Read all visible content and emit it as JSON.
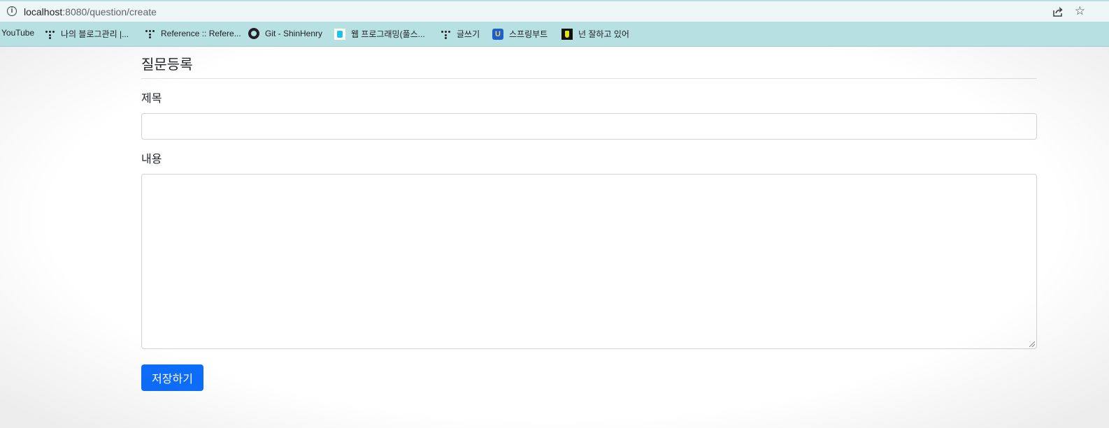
{
  "browser": {
    "url_host": "localhost",
    "url_path": ":8080/question/create",
    "bookmarks": [
      {
        "label": "YouTube",
        "icon": "none"
      },
      {
        "label": "나의 블로그관리 |...",
        "icon": "dots-icon"
      },
      {
        "label": "Reference :: Refere...",
        "icon": "dots-icon"
      },
      {
        "label": "Git - ShinHenry",
        "icon": "github-icon"
      },
      {
        "label": "웹 프로그래밍(풀스...",
        "icon": "hexagon-icon"
      },
      {
        "label": "글쓰기",
        "icon": "dots-icon"
      },
      {
        "label": "스프링부트",
        "icon": "u-icon"
      },
      {
        "label": "넌 잘하고 있어",
        "icon": "hand-icon"
      }
    ],
    "u_icon_letter": "U"
  },
  "page": {
    "title": "질문등록",
    "subject_label": "제목",
    "subject_value": "",
    "content_label": "내용",
    "content_value": "",
    "save_button": "저장하기"
  },
  "colors": {
    "bookmark_bar": "#b7e0e3",
    "primary_button": "#0d6efd"
  }
}
